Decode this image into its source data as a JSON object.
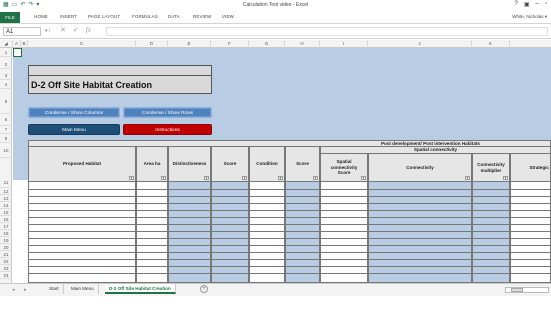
{
  "window": {
    "title": "Calculation Tool video - Excel",
    "controls": [
      "?",
      "▣",
      "–",
      "▫"
    ]
  },
  "ribbon": {
    "file": "FILE",
    "tabs": [
      "HOME",
      "INSERT",
      "PAGE LAYOUT",
      "FORMULAS",
      "DATA",
      "REVIEW",
      "VIEW"
    ],
    "user": "White, Nicholas ▾"
  },
  "formula_bar": {
    "name_box": "A1",
    "formula": ""
  },
  "columns": [
    "A",
    "B",
    "C",
    "D",
    "E",
    "F",
    "G",
    "H",
    "I",
    "J",
    "K"
  ],
  "rows": [
    "1",
    "2",
    "3",
    "4",
    "5",
    "6",
    "7",
    "8",
    "10",
    "11",
    "12",
    "13",
    "14",
    "15",
    "16",
    "17",
    "18",
    "19",
    "20",
    "21",
    "22",
    "23",
    "24"
  ],
  "sheet": {
    "title": "D-2 Off Site Habitat Creation",
    "buttons": {
      "condense_columns": "Condense / Show Columns",
      "condense_rows": "Condense / Show Rows",
      "main_menu": "Main Menu",
      "instructions": "Instructions"
    },
    "table": {
      "group_header": "Post development/ Post intervention Habitats",
      "sub_header": "Spatial connectivity",
      "headers": {
        "proposed_habitat": "Proposed Habitat",
        "area": "Area ha",
        "distinctiveness": "Distinctiveness",
        "score": "Score",
        "condition": "Condition",
        "score2": "Score",
        "spatial_score": "Spatial connectivity Score",
        "connectivity": "Connectivity",
        "multiplier": "Connectivity multiplier",
        "strategic": "Strategic"
      }
    }
  },
  "sheet_tabs": {
    "tabs": [
      "Start",
      "Main Menu",
      "D-2 Off Site Habitat Creation"
    ],
    "active": "D-2 Off Site Habitat Creation",
    "add": "+"
  },
  "colors": {
    "excel_green": "#217346",
    "sheet_blue": "#b8cce4",
    "button_blue": "#4f81bd",
    "button_dark": "#1f4e79",
    "button_red": "#c00000"
  }
}
